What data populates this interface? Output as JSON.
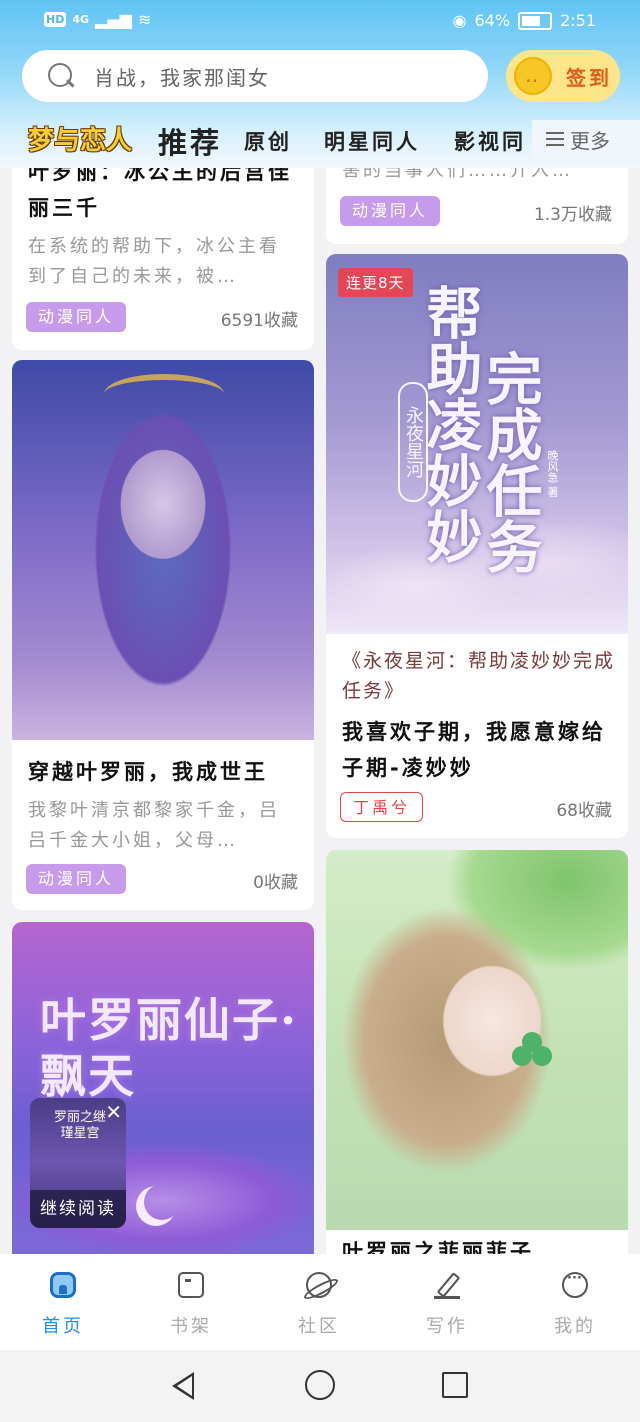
{
  "status_bar": {
    "network": "4G",
    "hd": "HD",
    "battery": "64%",
    "time": "2:51"
  },
  "search": {
    "placeholder": "肖战，我家那闺女"
  },
  "signin": {
    "label": "签到"
  },
  "tabs": [
    {
      "label": "梦与恋人"
    },
    {
      "label": "推荐"
    },
    {
      "label": "原创"
    },
    {
      "label": "明星同人"
    },
    {
      "label": "影视同"
    }
  ],
  "more": {
    "label": "更多"
  },
  "cards": {
    "a": {
      "title": "叶罗丽：冰公主的后宫佳丽三千",
      "desc": "在系统的帮助下，冰公主看到了自己的未来，被…",
      "tag": "动漫同人",
      "favs": "6591收藏"
    },
    "b": {
      "desc": "害的当事人们……介入…",
      "tag": "动漫同人",
      "favs": "1.3万收藏"
    },
    "c": {
      "title": "穿越叶罗丽，我成世王",
      "desc": "我黎叶清京都黎家千金，吕吕千金大小姐，父母…",
      "tag": "动漫同人",
      "favs": "0收藏"
    },
    "d": {
      "badge": "连更8天",
      "cover_title_1": "帮助凌妙妙",
      "cover_title_2": "完成任务",
      "cover_series": "永夜星河",
      "cover_author": "晚风急 著",
      "book_title": "《永夜星河：帮助凌妙妙完成任务》",
      "title": "我喜欢子期，我愿意嫁给子期-凌妙妙",
      "tag": "丁禹兮",
      "favs": "68收藏"
    },
    "e": {
      "cover_title": "叶罗丽仙子·飘天"
    },
    "f": {
      "title": "叶罗丽之菲丽菲子"
    }
  },
  "continue_reading": {
    "cover_title": "罗丽之继瑾星宫",
    "label": "继续阅读",
    "close": "✕"
  },
  "bottom_nav": [
    {
      "label": "首页",
      "icon": "home-icon",
      "active": true
    },
    {
      "label": "书架",
      "icon": "bookshelf-icon",
      "active": false
    },
    {
      "label": "社区",
      "icon": "planet-icon",
      "active": false
    },
    {
      "label": "写作",
      "icon": "pen-icon",
      "active": false
    },
    {
      "label": "我的",
      "icon": "chat-icon",
      "active": false
    }
  ],
  "colors": {
    "accent": "#1f8ff0",
    "tag_purple": "#c79bec",
    "badge_red": "#e54656",
    "signin_orange": "#e45a1c"
  }
}
